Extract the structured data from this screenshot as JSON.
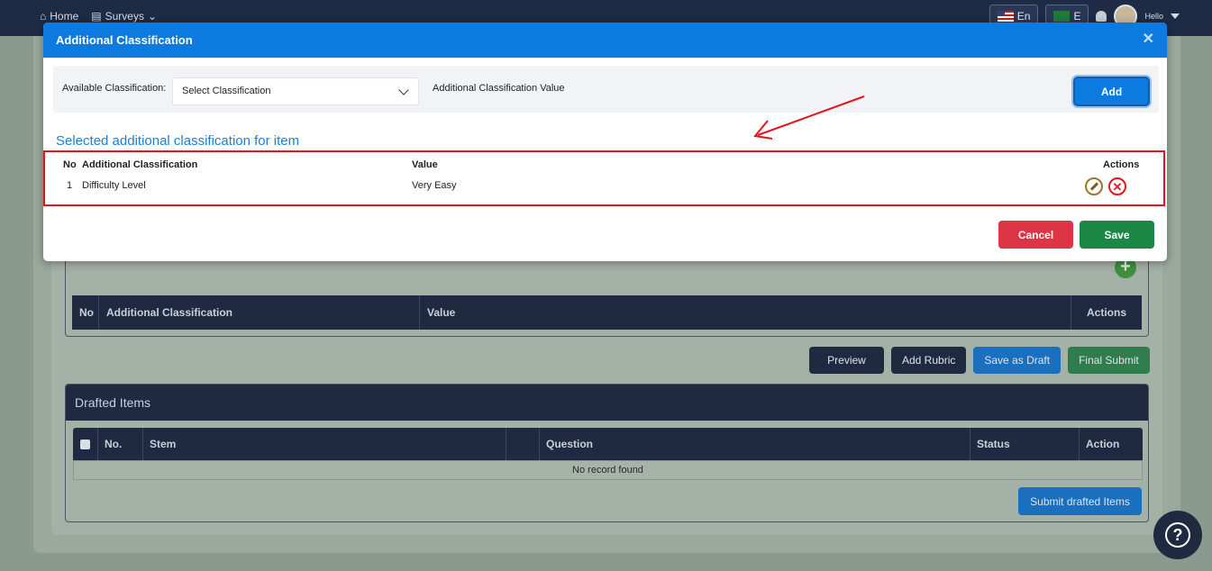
{
  "topbar": {
    "home": "Home",
    "surveys": "Surveys",
    "lang_en": "En",
    "lang_ar": "E",
    "hello": "Hello"
  },
  "background": {
    "class_table_headers": [
      "No",
      "Additional Classification",
      "Value",
      "Actions"
    ],
    "buttons": {
      "preview": "Preview",
      "add_rubric": "Add Rubric",
      "save_draft": "Save as Draft",
      "final_submit": "Final Submit"
    },
    "drafted": {
      "title": "Drafted Items",
      "headers": [
        "No.",
        "Stem",
        "",
        "Question",
        "Status",
        "Action"
      ],
      "empty": "No record found",
      "submit": "Submit drafted Items"
    }
  },
  "modal": {
    "title": "Additional Classification",
    "available_label": "Available Classification:",
    "select_value": "Select Classification",
    "value_label": "Additional Classification Value",
    "add_button": "Add",
    "section_title": "Selected additional classification for item",
    "table": {
      "headers": {
        "no": "No",
        "classification": "Additional Classification",
        "value": "Value",
        "actions": "Actions"
      },
      "rows": [
        {
          "no": "1",
          "classification": "Difficulty Level",
          "value": "Very Easy"
        }
      ]
    },
    "cancel": "Cancel",
    "save": "Save"
  },
  "colors": {
    "primary": "#0d7ae0",
    "danger": "#dc3545",
    "success": "#1a8745",
    "annotation": "#e3141c"
  },
  "icons": [
    "home-icon",
    "surveys-icon",
    "bell-icon",
    "close-icon",
    "chevron-down-icon",
    "edit-icon",
    "delete-icon",
    "plus-icon",
    "help-icon",
    "annotation-arrow-icon"
  ]
}
